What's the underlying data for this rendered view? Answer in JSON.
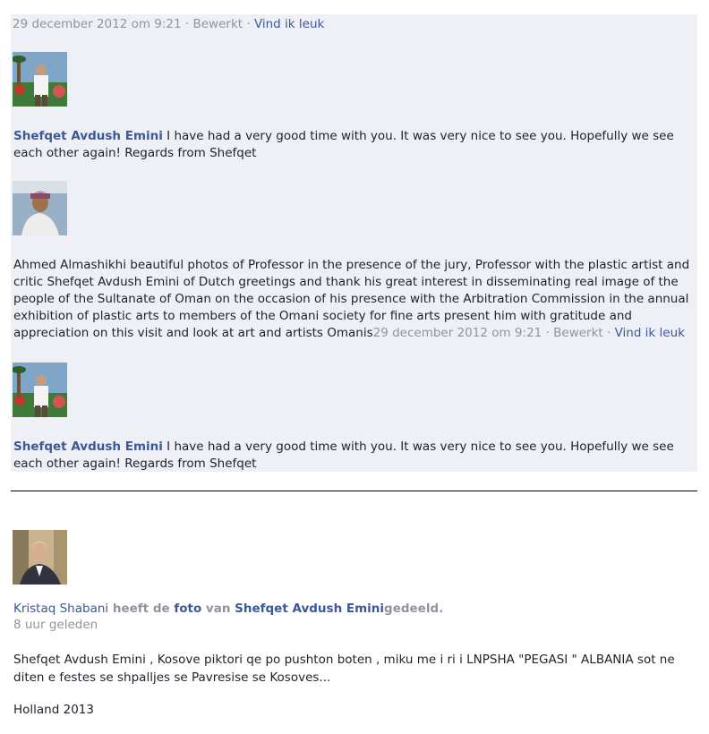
{
  "block1": {
    "date": "29 december 2012 om 9:21",
    "sep1": " · ",
    "edited": "Bewerkt",
    "sep2": " · ",
    "like": "Vind ik leuk"
  },
  "comment1": {
    "author": "Shefqet Avdush Emini",
    "text": " I have had a very good time with you. It was very nice to see you. Hopefully we see each other again! Regards from Shefqet"
  },
  "comment2": {
    "text": "Ahmed Almashikhi beautiful photos of Professor in the presence of the jury, Professor with the plastic artist and critic Shefqet Avdush Emini of Dutch greetings and thank his great interest in disseminating real image of the people of the Sultanate of Oman on the occasion of his presence with the Arbitration Commission in the annual exhibition of plastic arts to members of the Omani society for fine arts present him with gratitude and appreciation on this visit and look at art and artists Omanis",
    "date": "29 december 2012 om 9:21",
    "sep1": " · ",
    "edited": "Bewerkt",
    "sep2": " · ",
    "like": "Vind ik leuk"
  },
  "comment3": {
    "author": "Shefqet Avdush Emini",
    "text": " I have had a very good time with you. It was very nice to see you. Hopefully we see each other again! Regards from Shefqet"
  },
  "post": {
    "sharer": "Kristaq Shabani",
    "shared_text1": " heeft de ",
    "foto": "foto",
    "shared_text2": " van ",
    "owner": "Shefqet Avdush Emini",
    "shared_text3": "gedeeld.",
    "time": "8 uur geleden",
    "body": "Shefqet Avdush Emini , Kosove piktori qe po pushton boten , miku me i ri i LNPSHA \"PEGASI \" ALBANIA sot ne diten e festes se shpalljes se Pavresise se Kosoves...",
    "location": "Holland 2013"
  }
}
